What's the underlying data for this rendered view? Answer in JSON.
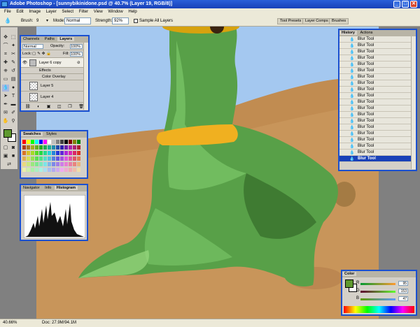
{
  "app": {
    "title": "Adobe Photoshop - [sunnybikinidone.psd @ 40.7% (Layer 19, RGB/8)]",
    "min": "_",
    "max": "□",
    "close": "✕"
  },
  "menu": [
    "File",
    "Edit",
    "Image",
    "Layer",
    "Select",
    "Filter",
    "View",
    "Window",
    "Help"
  ],
  "options": {
    "brush_label": "Brush:",
    "brush_size": "9",
    "mode_label": "Mode:",
    "mode_value": "Normal",
    "strength_label": "Strength:",
    "strength_value": "92%",
    "sample_all": "Sample All Layers"
  },
  "well_tabs": [
    "Tool Presets",
    "Layer Comps",
    "Brushes"
  ],
  "layers_panel": {
    "tabs": [
      "Channels",
      "Paths",
      "Layers"
    ],
    "blend_mode": "Normal",
    "opacity_label": "Opacity:",
    "opacity": "100%",
    "lock_label": "Lock:",
    "fill_label": "Fill:",
    "fill": "100%",
    "layers": [
      {
        "name": "Layer 6 copy",
        "visible": true,
        "fx": "⊘"
      },
      {
        "name": "Effects"
      },
      {
        "name": "Color Overlay"
      },
      {
        "name": "Layer 5",
        "visible": false
      },
      {
        "name": "Layer 4",
        "visible": false
      }
    ]
  },
  "swatches_panel": {
    "tabs": [
      "Swatches",
      "Styles"
    ]
  },
  "navigator_panel": {
    "tabs": [
      "Navigator",
      "Info",
      "Histogram"
    ]
  },
  "history_panel": {
    "tabs": [
      "History",
      "Actions"
    ],
    "items": [
      "Blur Tool",
      "Blur Tool",
      "Blur Tool",
      "Blur Tool",
      "Blur Tool",
      "Blur Tool",
      "Blur Tool",
      "Blur Tool",
      "Blur Tool",
      "Blur Tool",
      "Blur Tool",
      "Blur Tool",
      "Blur Tool",
      "Blur Tool",
      "Blur Tool",
      "Blur Tool",
      "Blur Tool",
      "Blur Tool",
      "Blur Tool",
      "Blur Tool"
    ],
    "selected_index": 19
  },
  "color_panel": {
    "tab": "Color",
    "r_label": "R",
    "r": "95",
    "g_label": "G",
    "g": "153",
    "b_label": "B",
    "b": "47",
    "foreground": "#5f992f",
    "background": "#ffffff"
  },
  "status": {
    "zoom": "40.66%",
    "doc": "Doc: 27.9M/94.1M"
  },
  "colors": {
    "sky": "#a4c8f0",
    "sand": "#c8955a",
    "skin": "#58a048",
    "bikini": "#f0b020",
    "panel_border": "#1a50d0"
  }
}
